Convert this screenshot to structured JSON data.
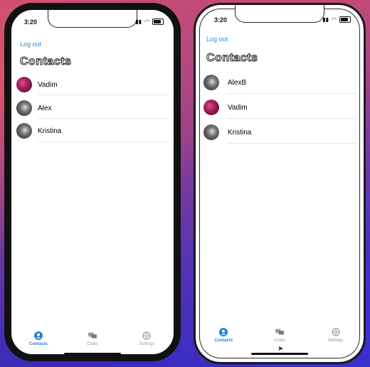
{
  "phones": [
    {
      "status_time": "3:20",
      "logout_label": "Log out",
      "title": "Contacts",
      "contacts": [
        {
          "name": "Vadim",
          "avatar": "pink-flower-avatar"
        },
        {
          "name": "Alex",
          "avatar": "dark-portrait-avatar"
        },
        {
          "name": "Kristina",
          "avatar": "dark-portrait-avatar"
        }
      ],
      "tabs": [
        {
          "label": "Contacts",
          "icon": "person-circle-icon",
          "active": true
        },
        {
          "label": "Chats",
          "icon": "chat-bubbles-icon",
          "active": false
        },
        {
          "label": "Settings",
          "icon": "gear-icon",
          "active": false
        }
      ]
    },
    {
      "status_time": "3:20",
      "logout_label": "Log out",
      "title": "Contacts",
      "contacts": [
        {
          "name": "AlexB",
          "avatar": "dark-portrait-avatar"
        },
        {
          "name": "Vadim",
          "avatar": "pink-flower-avatar"
        },
        {
          "name": "Kristina",
          "avatar": "dark-portrait-avatar"
        }
      ],
      "tabs": [
        {
          "label": "Contacts",
          "icon": "person-circle-icon",
          "active": true
        },
        {
          "label": "Chats",
          "icon": "chat-bubbles-icon",
          "active": false
        },
        {
          "label": "Settings",
          "icon": "gear-icon",
          "active": false
        }
      ]
    }
  ],
  "colors": {
    "accent": "#2b8cd8",
    "tab_inactive": "#999999"
  }
}
